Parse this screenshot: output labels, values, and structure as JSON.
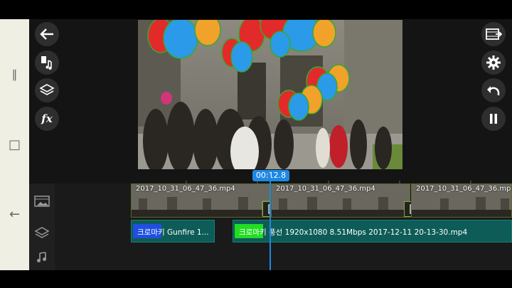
{
  "navbar": {
    "recents_glyph": "∥",
    "home_glyph": "□",
    "back_glyph": "←"
  },
  "left_tools": {
    "back_icon": "arrow-left-icon",
    "media_icon": "media-music-icon",
    "layer_icon": "layers-icon",
    "fx_label": "fx"
  },
  "right_tools": {
    "export_icon": "film-export-icon",
    "settings_icon": "gear-icon",
    "undo_icon": "undo-icon",
    "pause_icon": "pause-icon"
  },
  "timeline": {
    "current_time": "00:12.8",
    "clips": [
      {
        "label": "2017_10_31_06_47_36.mp4"
      },
      {
        "label": "2017_10_31_06_47_36.mp4"
      },
      {
        "label": "2017_10_31_06_47_36.mp4"
      }
    ],
    "layers": [
      {
        "label": "크로마키 Gunfire 1..."
      },
      {
        "label": "크로마키 풍선 1920x1080 8.51Mbps 2017-12-11 20-13-30.mp4"
      }
    ]
  },
  "colors": {
    "accent": "#1e88e5",
    "layer_track": "#0e5c57",
    "chroma_blue": "#1e4fe0",
    "chroma_green": "#22dd22"
  }
}
